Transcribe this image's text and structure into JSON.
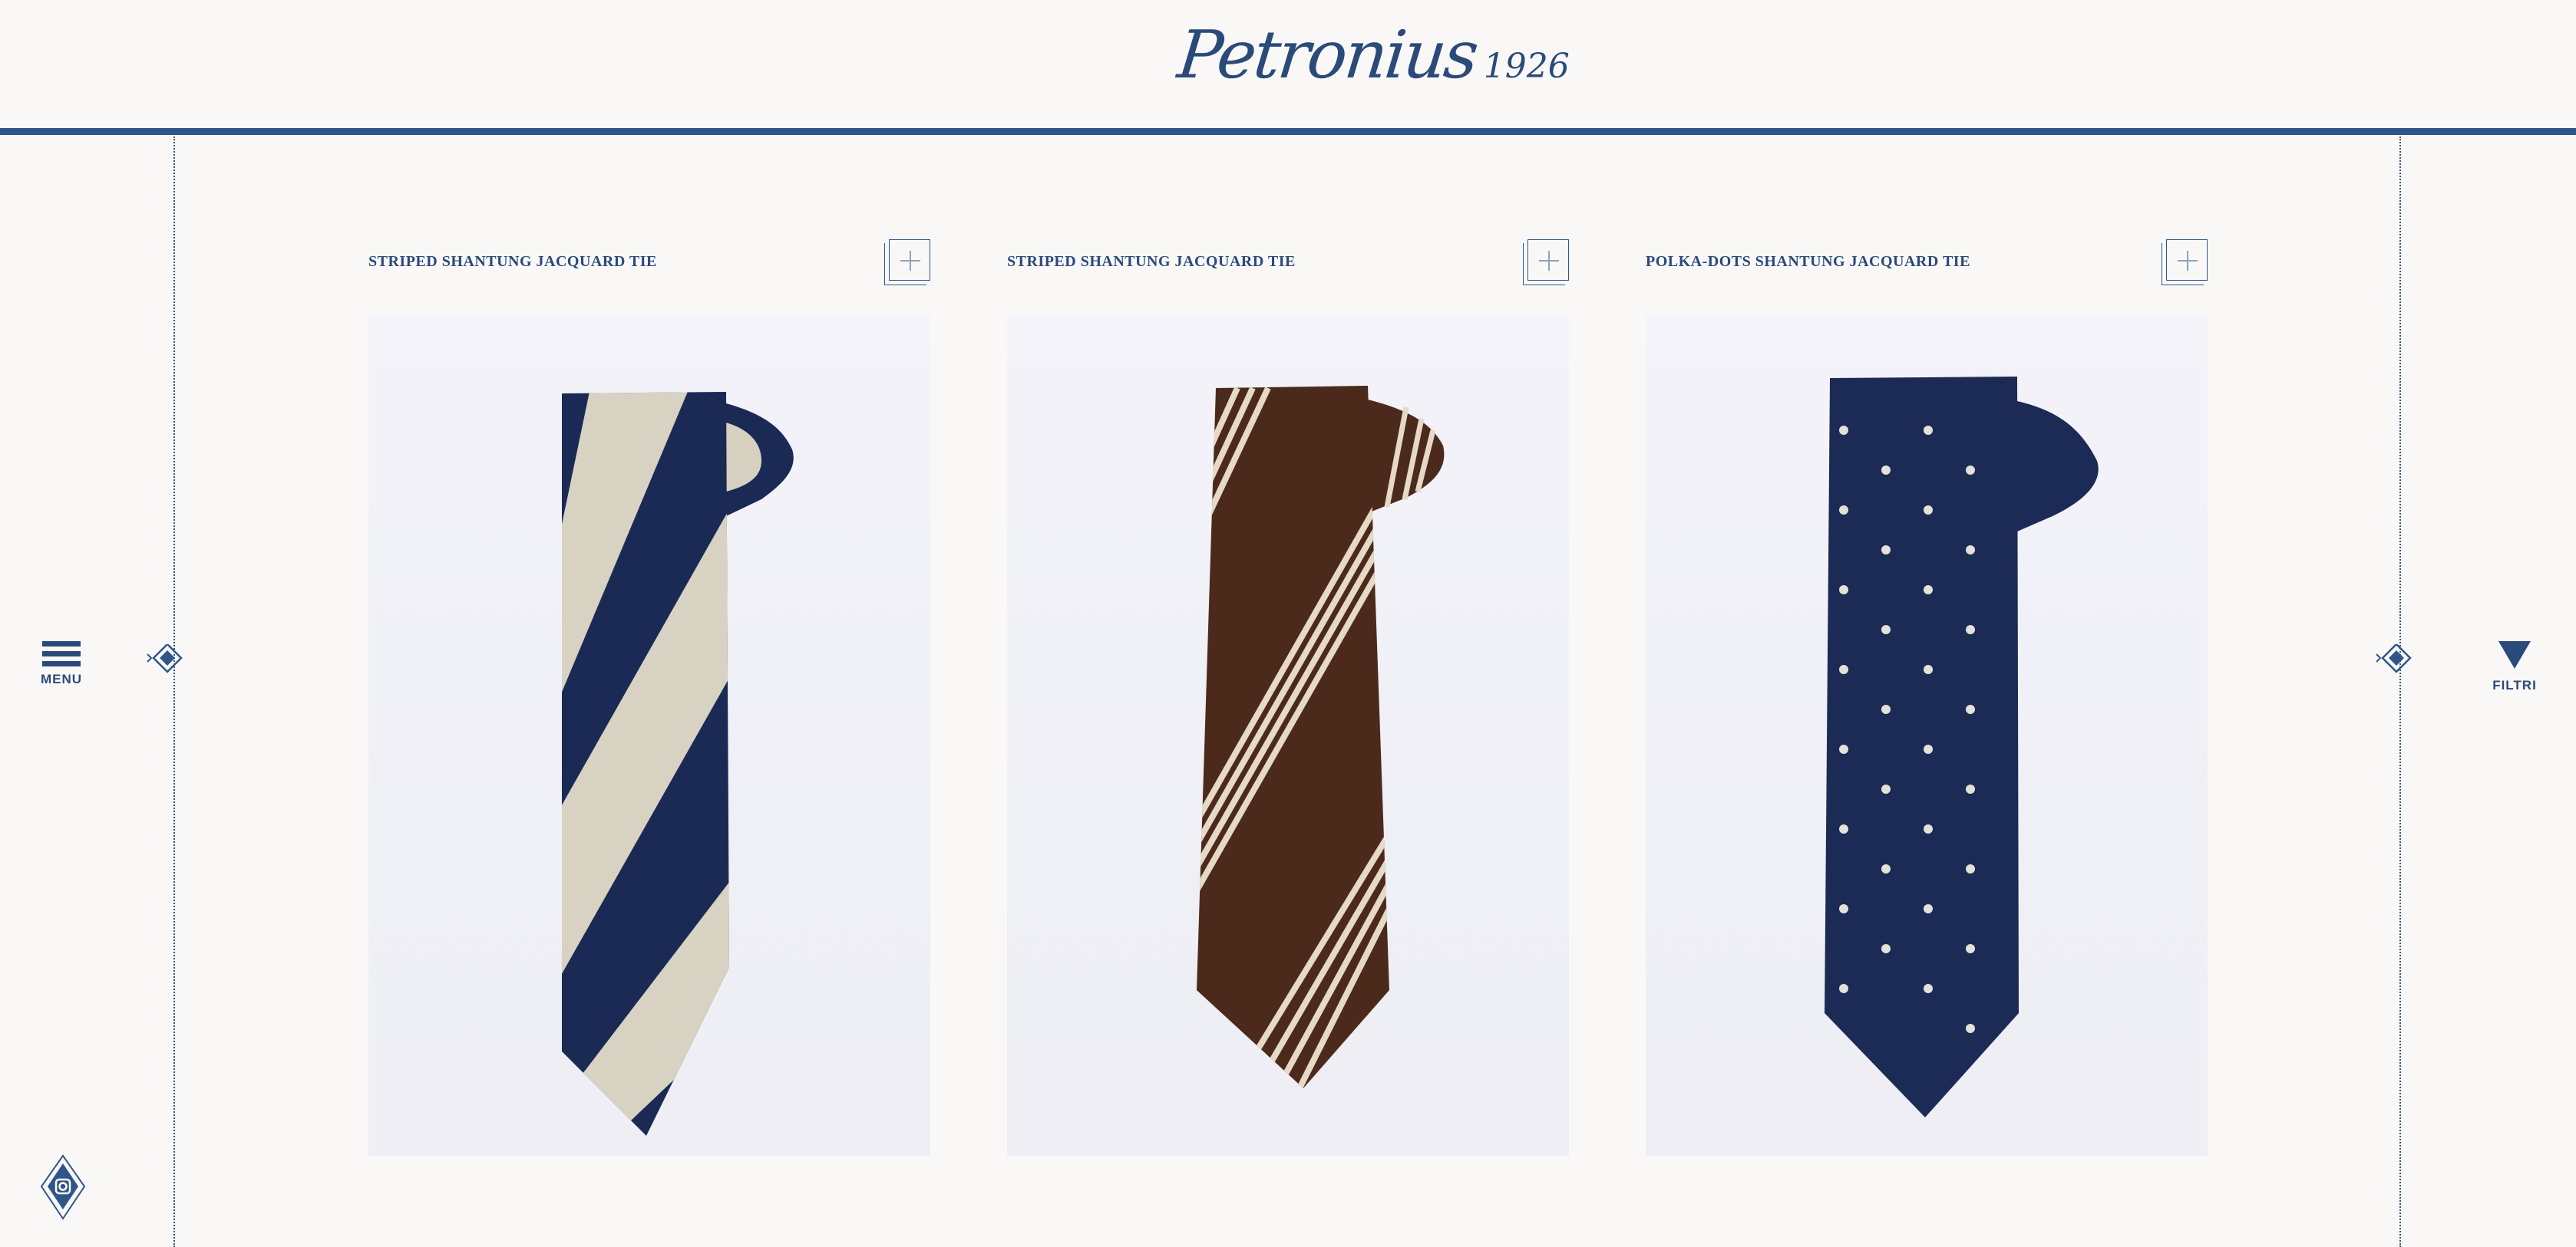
{
  "brand": {
    "name": "Petronius",
    "year": "1926"
  },
  "nav": {
    "menu_label": "MENU",
    "filter_label": "FILTRI"
  },
  "colors": {
    "accent": "#2f5689",
    "background": "#f9f8f7"
  },
  "icons": {
    "menu": "hamburger-icon",
    "filter": "triangle-down-icon",
    "prev": "diamond-arrow-icon",
    "next": "diamond-arrow-icon",
    "social": "instagram-icon",
    "add": "plus-icon"
  },
  "products": [
    {
      "title": "STRIPED SHANTUNG JACQUARD TIE",
      "image": "navy and beige striped tie"
    },
    {
      "title": "STRIPED SHANTUNG JACQUARD TIE",
      "image": "brown tie with cream stripes"
    },
    {
      "title": "POLKA-DOTS SHANTUNG JACQUARD TIE",
      "image": "navy polka-dot tie"
    }
  ]
}
